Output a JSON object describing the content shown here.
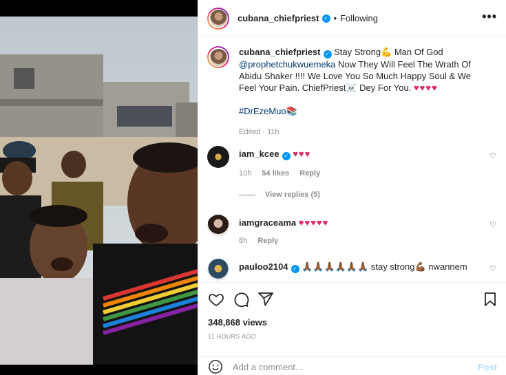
{
  "header": {
    "username": "cubana_chiefpriest",
    "separator": "•",
    "follow_status": "Following",
    "more_label": "•••"
  },
  "caption": {
    "username": "cubana_chiefpriest",
    "text_part1": "Stay Strong💪 Man Of God",
    "mention": "@prophetchukwuemeka",
    "text_part2": "Now They Will Feel The Wrath Of Abidu Shaker !!!! We Love You So Much Happy Soul & We Feel Your Pain. ChiefPriest☠️ Dey For You.",
    "hearts": "♥♥♥♥",
    "hashtag": "#DrEzeMuo📚",
    "edited": "Edited · 11h"
  },
  "comments": [
    {
      "username": "iam_kcee",
      "verified": true,
      "text": "♥♥♥",
      "time": "10h",
      "likes": "54 likes",
      "reply": "Reply"
    },
    {
      "username": "iamgraceama",
      "verified": false,
      "text": "♥♥♥♥♥",
      "time": "8h",
      "likes": "",
      "reply": "Reply"
    },
    {
      "username": "pauloo2104",
      "verified": true,
      "text_part1": "🙏🏾🙏🏾🙏🏾🙏🏾🙏🏾🙏🏾",
      "text_part2": "stay strong💪🏾 nwannem"
    }
  ],
  "view_replies": "View replies (5)",
  "actions": {
    "views": "348,868 views",
    "time_ago": "11 HOURS AGO"
  },
  "add_comment": {
    "placeholder": "Add a comment...",
    "post_label": "Post"
  },
  "colors": {
    "link": "#00376b",
    "meta": "#8e8e8e",
    "verified": "#0095f6",
    "heart": "#e0245e",
    "post_disabled": "#b2dffc"
  },
  "icons": [
    "more-options-icon",
    "verified-badge-icon",
    "like-icon",
    "comment-icon",
    "share-icon",
    "bookmark-icon",
    "emoji-icon"
  ]
}
